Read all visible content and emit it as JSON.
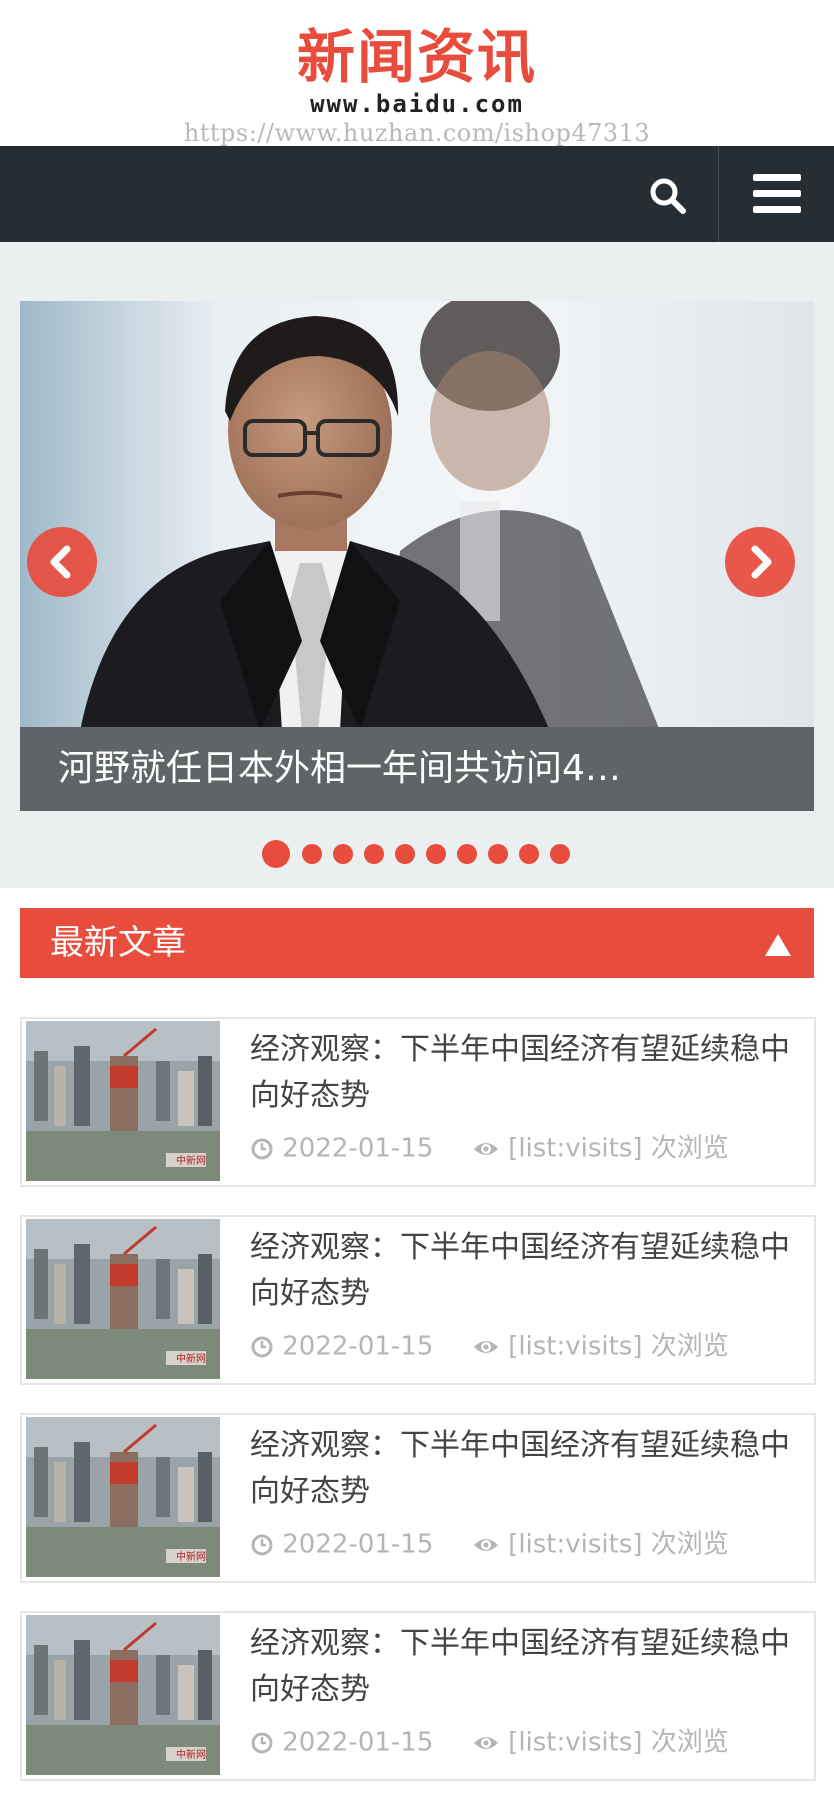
{
  "header": {
    "logo_title": "新闻资讯",
    "logo_domain": "www.baidu.com",
    "watermark": "https://www.huzhan.com/ishop47313"
  },
  "nav": {
    "search_icon": "search-icon",
    "menu_icon": "hamburger-menu-icon"
  },
  "slider": {
    "caption": "河野就任日本外相一年间共访问4…",
    "prev_icon": "chevron-left-icon",
    "next_icon": "chevron-right-icon",
    "slide_count": 10,
    "active_index": 0
  },
  "section": {
    "title": "最新文章",
    "toggle_icon": "triangle-up-icon"
  },
  "articles": [
    {
      "title": "经济观察：下半年中国经济有望延续稳中向好态势",
      "date": "2022-01-15",
      "visits": "[list:visits] 次浏览"
    },
    {
      "title": "经济观察：下半年中国经济有望延续稳中向好态势",
      "date": "2022-01-15",
      "visits": "[list:visits] 次浏览"
    },
    {
      "title": "经济观察：下半年中国经济有望延续稳中向好态势",
      "date": "2022-01-15",
      "visits": "[list:visits] 次浏览"
    },
    {
      "title": "经济观察：下半年中国经济有望延续稳中向好态势",
      "date": "2022-01-15",
      "visits": "[list:visits] 次浏览"
    }
  ],
  "colors": {
    "accent": "#e84c3d",
    "navbar": "#272e33",
    "caption_bg": "#5f6467",
    "meta_text": "#b5b5b5"
  }
}
